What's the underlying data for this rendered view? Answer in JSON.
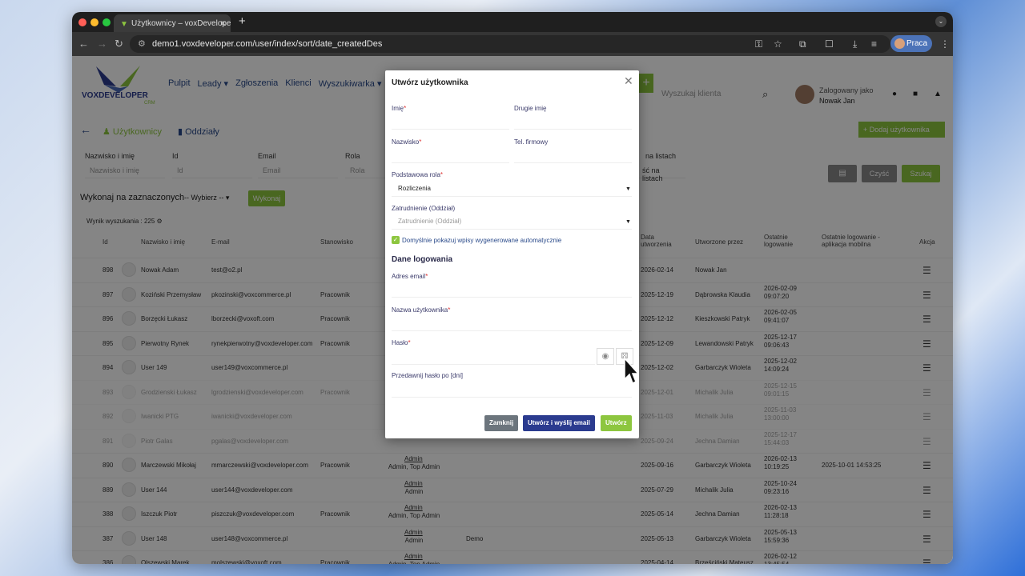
{
  "browser": {
    "tab_title": "Użytkownicy – voxDeveloper",
    "url": "demo1.voxdeveloper.com/user/index/sort/date_createdDes",
    "profile": "Praca"
  },
  "header": {
    "logo_text": "VOXDEVELOPER",
    "logo_sub": "CRM",
    "menu": [
      "Pulpit",
      "Leady ▾",
      "Zgłoszenia",
      "Klienci",
      "Wyszukiwarka ▾"
    ],
    "search_placeholder": "Wyszukaj klienta",
    "logged_as_label": "Zalogowany jako",
    "logged_as_name": "Nowak Jan"
  },
  "tabs": {
    "users": "Użytkownicy",
    "branches": "Oddziały",
    "add_user": "+ Dodaj użytkownika"
  },
  "filters": {
    "labels": [
      "Nazwisko i imię",
      "Id",
      "Email",
      "Rola",
      "na listach"
    ],
    "placeholders": [
      "Nazwisko i imię",
      "Id",
      "Email",
      "Rola",
      "ść na listach"
    ],
    "clear": "Czyść",
    "search": "Szukaj"
  },
  "bulk": {
    "label": "Wykonaj na zaznaczonych",
    "select": "-- Wybierz --",
    "button": "Wykonaj"
  },
  "result_count": "Wynik wyszukania : 225",
  "table": {
    "headers": [
      "Id",
      "Nazwisko i imię",
      "E-mail",
      "Stanowisko",
      "Data utworzenia",
      "Utworzone przez",
      "Ostatnie logowanie",
      "Ostatnie logowanie - aplikacja mobilna",
      "Akcja"
    ],
    "rows": [
      {
        "id": "898",
        "name": "Nowak Adam",
        "email": "test@o2.pl",
        "position": "",
        "role1": "",
        "role2": "",
        "created": "2026-02-14",
        "by": "Nowak Jan",
        "last1": "",
        "last2": "",
        "mobile": "",
        "faded": false
      },
      {
        "id": "897",
        "name": "Koziński Przemysław",
        "email": "pkozinski@voxcommerce.pl",
        "position": "Pracownik",
        "role1": "",
        "role2": "",
        "created": "2025-12-19",
        "by": "Dąbrowska Klaudia",
        "last1": "2026-02-09",
        "last2": "09:07:20",
        "mobile": "",
        "faded": false
      },
      {
        "id": "896",
        "name": "Borzęcki Łukasz",
        "email": "lborzecki@voxoft.com",
        "position": "Pracownik",
        "role1": "",
        "role2": "",
        "created": "2025-12-12",
        "by": "Kieszkowski Patryk",
        "last1": "2026-02-05",
        "last2": "09:41:07",
        "mobile": "",
        "faded": false
      },
      {
        "id": "895",
        "name": "Pierwotny Rynek",
        "email": "rynekpierwotny@voxdeveloper.com",
        "position": "Pracownik",
        "role1": "",
        "role2": "",
        "created": "2025-12-09",
        "by": "Lewandowski Patryk",
        "last1": "2025-12-17",
        "last2": "09:06:43",
        "mobile": "",
        "faded": false
      },
      {
        "id": "894",
        "name": "User 149",
        "email": "user149@voxcommerce.pl",
        "position": "",
        "role1": "",
        "role2": "",
        "created": "2025-12-02",
        "by": "Garbarczyk Wioleta",
        "last1": "2025-12-02",
        "last2": "14:09:24",
        "mobile": "",
        "faded": false
      },
      {
        "id": "893",
        "name": "Grodzienski Łukasz",
        "email": "lgrodzienski@voxdeveloper.com",
        "position": "Pracownik",
        "role1": "",
        "role2": "",
        "created": "2025-12-01",
        "by": "Michalik Julia",
        "last1": "2025-12-15",
        "last2": "09:01:15",
        "mobile": "",
        "faded": true
      },
      {
        "id": "892",
        "name": "Iwanicki PTG",
        "email": "iwanicki@voxdeveloper.com",
        "position": "",
        "role1": "",
        "role2": "",
        "created": "2025-11-03",
        "by": "Michalik Julia",
        "last1": "2025-11-03",
        "last2": "13:00:00",
        "mobile": "",
        "faded": true
      },
      {
        "id": "891",
        "name": "Piotr Galas",
        "email": "pgalas@voxdeveloper.com",
        "position": "",
        "role1": "",
        "role2": "",
        "created": "2025-09-24",
        "by": "Jechna Damian",
        "last1": "2025-12-17",
        "last2": "15:44:03",
        "mobile": "",
        "faded": true
      },
      {
        "id": "890",
        "name": "Marczewski Mikołaj",
        "email": "mmarczewski@voxdeveloper.com",
        "position": "Pracownik",
        "role1": "Admin",
        "role2": "Admin, Top Admin",
        "created": "2025-09-16",
        "by": "Garbarczyk Wioleta",
        "last1": "2026-02-13",
        "last2": "10:19:25",
        "mobile": "2025-10-01 14:53:25",
        "faded": false
      },
      {
        "id": "889",
        "name": "User 144",
        "email": "user144@voxdeveloper.com",
        "position": "",
        "role1": "Admin",
        "role2": "Admin",
        "created": "2025-07-29",
        "by": "Michalik Julia",
        "last1": "2025-10-24",
        "last2": "09:23:16",
        "mobile": "",
        "faded": false
      },
      {
        "id": "388",
        "name": "Iszczuk Piotr",
        "email": "piszczuk@voxdeveloper.com",
        "position": "Pracownik",
        "role1": "Admin",
        "role2": "Admin, Top Admin",
        "created": "2025-05-14",
        "by": "Jechna Damian",
        "last1": "2026-02-13",
        "last2": "11:28:18",
        "mobile": "",
        "faded": false
      },
      {
        "id": "387",
        "name": "User 148",
        "email": "user148@voxcommerce.pl",
        "position": "",
        "role1": "Admin",
        "role2": "Admin",
        "branch": "Demo",
        "created": "2025-05-13",
        "by": "Garbarczyk Wioleta",
        "last1": "2025-05-13",
        "last2": "15:59:36",
        "mobile": "",
        "faded": false
      },
      {
        "id": "386",
        "name": "Olszewski Marek",
        "email": "molszewski@voxoft.com",
        "position": "Pracownik",
        "role1": "Admin",
        "role2": "Admin, Top Admin",
        "created": "2025-04-14",
        "by": "Brześciński Mateusz",
        "last1": "2026-02-12",
        "last2": "13:45:54",
        "mobile": "",
        "faded": false
      }
    ]
  },
  "modal": {
    "title": "Utwórz użytkownika",
    "first_name": "Imię",
    "middle_name": "Drugie imię",
    "last_name": "Nazwisko",
    "company_phone": "Tel. firmowy",
    "base_role": "Podstawowa rola",
    "base_role_value": "Rozliczenia",
    "employment": "Zatrudnienie (Oddział)",
    "employment_placeholder": "Zatrudnienie (Oddział)",
    "default_checkbox": "Domyślnie pokazuj wpisy wygenerowane automatycznie",
    "login_section": "Dane logowania",
    "email": "Adres email",
    "username": "Nazwa użytkownika",
    "password": "Hasło",
    "password_expiry": "Przedawnij hasło po [dni]",
    "btn_close": "Zamknij",
    "btn_create_send": "Utwórz i wyślij email",
    "btn_create": "Utwórz"
  },
  "colors": {
    "green": "#8dc63f",
    "navy": "#2b3b8f",
    "grey_btn": "#6c757d",
    "link": "#2a4a8a"
  }
}
